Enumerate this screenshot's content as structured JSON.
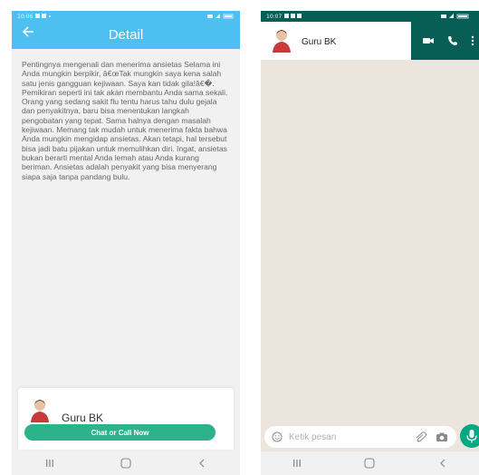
{
  "left_screen": {
    "status": {
      "time": "10:06"
    },
    "appbar": {
      "title": "Detail"
    },
    "body_text": "Pentingnya mengenali dan menerima ansietas Selama ini Anda mungkin berpikir, â€œTak mungkin saya kena salah satu jenis gangguan kejiwaan. Saya kan tidak gila!â€�. Pemikiran seperti ini tak akan membantu Anda sama sekali. Orang yang sedang sakit flu tentu harus tahu dulu gejala dan penyakitnya, baru bisa menentukan langkah pengobatan yang tepat. Sama halnya dengan masalah kejiwaan. Memang tak mudah untuk menerima fakta bahwa Anda mungkin mengidap ansietas. Akan tetapi, hal tersebut bisa jadi batu pijakan untuk memulihkan diri. Ingat, ansietas bukan berarti mental Anda lemah atau Anda kurang beriman. Ansietas adalah penyakit yang bisa menyerang siapa saja tanpa pandang bulu.",
    "counselor": {
      "name": "Guru BK",
      "button_label": "Chat or Call Now"
    },
    "colors": {
      "appbar": "#4dbff0",
      "button": "#2db38a"
    }
  },
  "right_screen": {
    "status": {
      "time": "10:07"
    },
    "chat_header": {
      "contact_name": "Guru BK",
      "actions": [
        "video-call-icon",
        "phone-icon",
        "more-icon"
      ]
    },
    "composer": {
      "placeholder": "Ketik pesan"
    },
    "colors": {
      "header": "#075e54",
      "wallpaper": "#ece5dd",
      "mic": "#00a884"
    }
  },
  "navbar": {
    "icons": [
      "recents-icon",
      "home-icon",
      "back-icon"
    ]
  }
}
